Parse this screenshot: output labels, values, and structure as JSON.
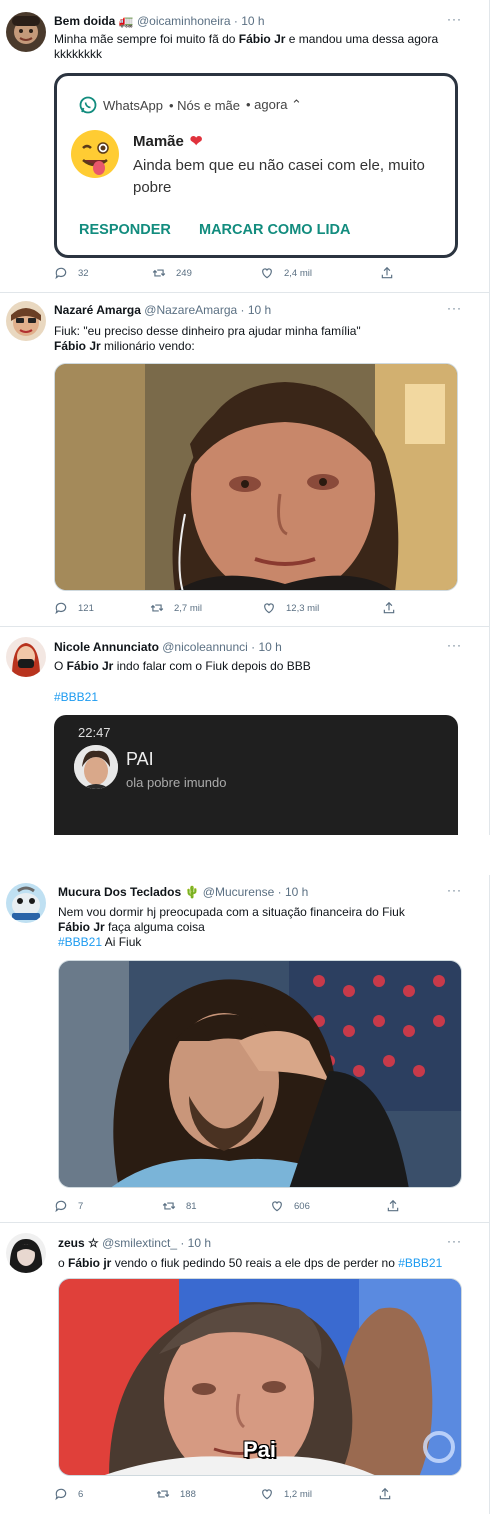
{
  "tweets": [
    {
      "name": "Bem doida",
      "handle": "@oicaminhoneira",
      "time": "· 10 h",
      "text_pre": "Minha mãe sempre foi muito fã do ",
      "text_bold": "Fábio Jr",
      "text_post": " e mandou uma dessa agora kkkkkkkk",
      "actions": {
        "replies": "32",
        "retweets": "249",
        "likes": "2,4 mil"
      },
      "notification": {
        "app": "WhatsApp",
        "source": "• Nós e mãe",
        "time": "• agora ⌃",
        "title": "Mamãe",
        "body": "Ainda bem que eu não casei com ele, muito pobre",
        "reply_label": "RESPONDER",
        "mark_read_label": "MARCAR COMO LIDA"
      }
    },
    {
      "name": "Nazaré Amarga",
      "handle": "@NazareAmarga",
      "time": "· 10 h",
      "line1": "Fiuk: \"eu preciso desse dinheiro pra ajudar minha família\"",
      "line2_bold": "Fábio Jr",
      "line2_post": " milionário vendo:",
      "actions": {
        "replies": "121",
        "retweets": "2,7 mil",
        "likes": "12,3 mil"
      }
    },
    {
      "name": "Nicole Annunciato",
      "handle": "@nicoleannunci",
      "time": "· 10 h",
      "text_pre": "O ",
      "text_bold": "Fábio Jr",
      "text_post": " indo falar com o Fiuk depois do BBB",
      "hashtag": "#BBB21",
      "screen": {
        "clock": "22:47",
        "caller": "PAI",
        "message": "ola pobre imundo"
      }
    },
    {
      "name": "Mucura Dos Teclados",
      "name_emoji": "🌵",
      "handle": "@Mucurense",
      "time": "· 10 h",
      "line1": "Nem vou dormir hj preocupada com a situação financeira do Fiuk",
      "line2_bold": "Fábio Jr",
      "line2_post": " faça alguma coisa",
      "hashtag": "#BBB21",
      "hashtag_post": " Ai Fiuk",
      "actions": {
        "replies": "7",
        "retweets": "81",
        "likes": "606"
      }
    },
    {
      "name": "zeus ☆",
      "handle": "@smilextinct_",
      "time": "· 10 h",
      "text_pre": "o ",
      "text_bold": "Fábio jr",
      "text_post": " vendo o fiuk pedindo 50 reais a ele dps de perder no ",
      "hashtag": "#BBB21",
      "caption": "Pai",
      "actions": {
        "replies": "6",
        "retweets": "188",
        "likes": "1,2 mil"
      }
    }
  ],
  "more_label": "···",
  "colors": {
    "whatsapp_green": "#128c7e",
    "link": "#1d9bf0",
    "muted": "#5b7083"
  }
}
